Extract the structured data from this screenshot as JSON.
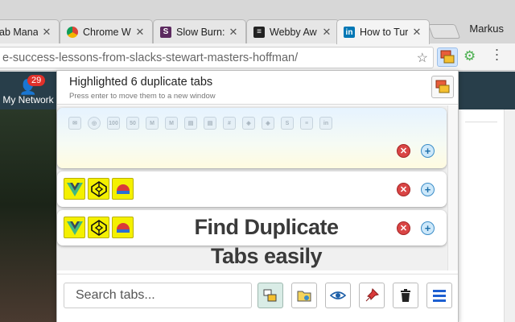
{
  "browser": {
    "profile_name": "Markus",
    "tabs": [
      {
        "title": "ab Manag",
        "active": false
      },
      {
        "title": "Chrome W",
        "active": false
      },
      {
        "title": "Slow Burn:",
        "active": false
      },
      {
        "title": "Webby Aw",
        "active": false
      },
      {
        "title": "How to Tur",
        "active": true
      }
    ],
    "url": "e-success-lessons-from-slacks-stewart-masters-hoffman/"
  },
  "page": {
    "network_label": "My Network",
    "network_count": "29"
  },
  "popup": {
    "title": "Highlighted 6 duplicate tabs",
    "subtitle": "Press enter to move them to a new window",
    "overlay_line1": "Find Duplicate",
    "overlay_line2": "Tabs easily",
    "search_placeholder": "Search tabs...",
    "first_group_favicons": [
      "mail-icon",
      "chrome-icon",
      "100-icon",
      "50-icon",
      "gmail-icon",
      "gmail-icon",
      "page-icon",
      "page-icon",
      "hash-icon",
      "codepen-icon",
      "codepen-icon",
      "s-icon",
      "lines-icon",
      "linkedin-icon"
    ],
    "accent_color": "#f4f000"
  }
}
